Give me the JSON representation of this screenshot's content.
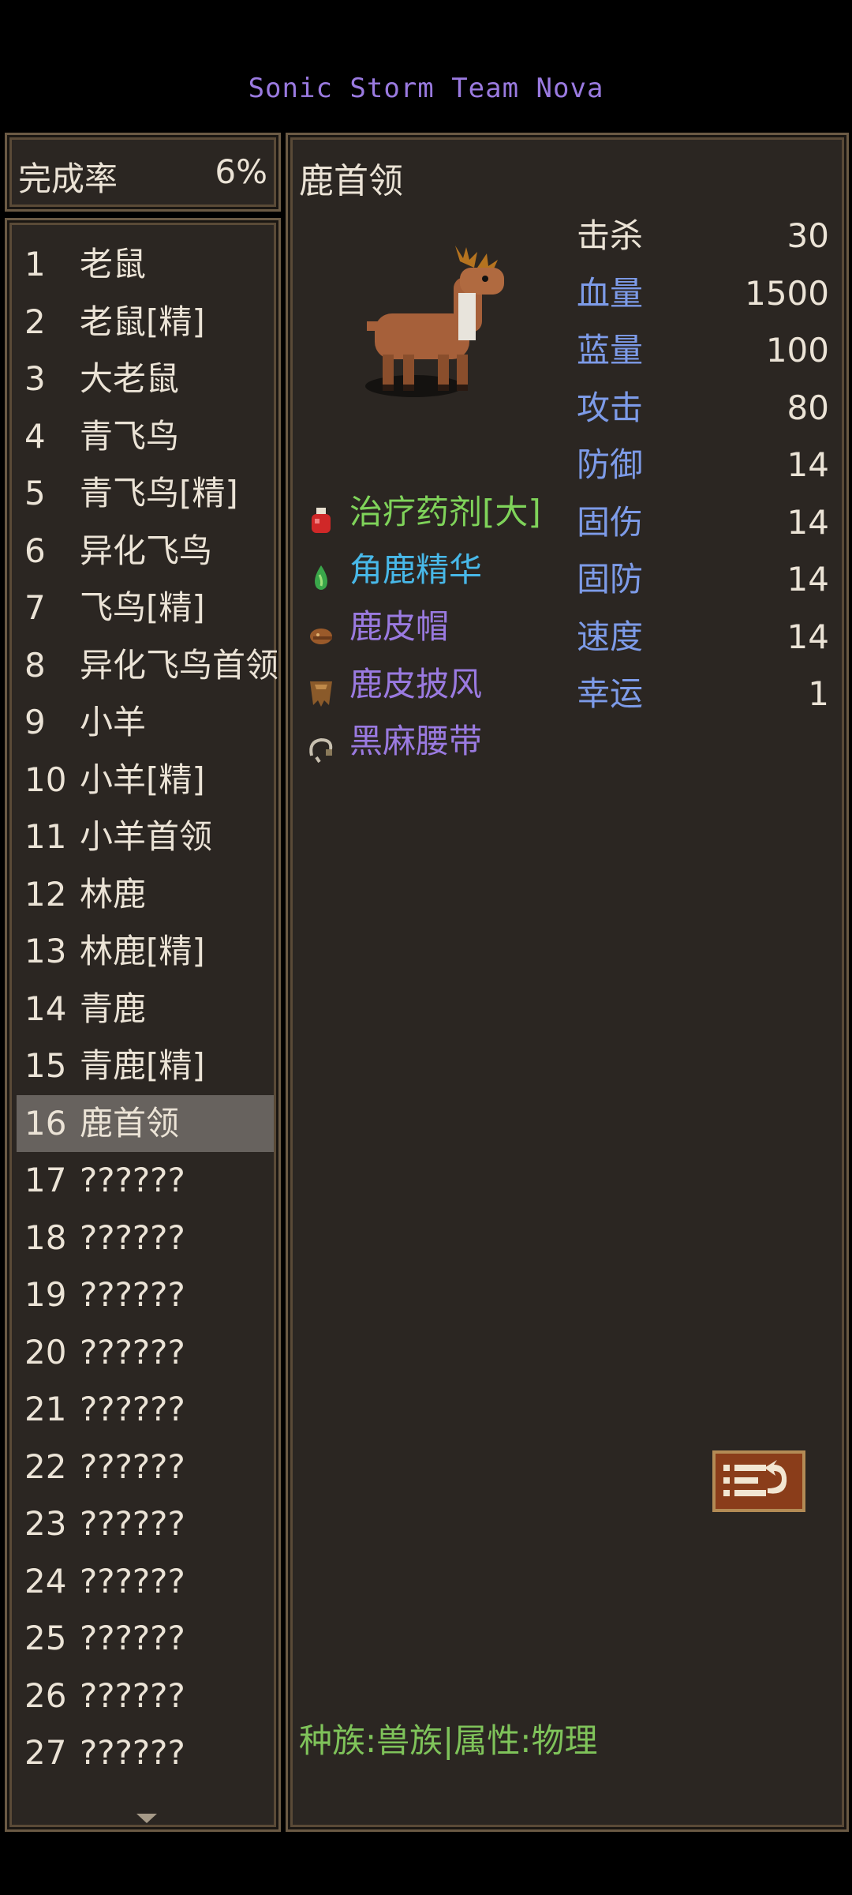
{
  "header": {
    "title": "Sonic Storm Team Nova"
  },
  "completion": {
    "label": "完成率",
    "value": "6%"
  },
  "monster_list": {
    "items": [
      {
        "num": "1",
        "name": "老鼠"
      },
      {
        "num": "2",
        "name": "老鼠[精]"
      },
      {
        "num": "3",
        "name": "大老鼠"
      },
      {
        "num": "4",
        "name": "青飞鸟"
      },
      {
        "num": "5",
        "name": "青飞鸟[精]"
      },
      {
        "num": "6",
        "name": "异化飞鸟"
      },
      {
        "num": "7",
        "name": "飞鸟[精]"
      },
      {
        "num": "8",
        "name": "异化飞鸟首领"
      },
      {
        "num": "9",
        "name": "小羊"
      },
      {
        "num": "10",
        "name": "小羊[精]"
      },
      {
        "num": "11",
        "name": "小羊首领"
      },
      {
        "num": "12",
        "name": "林鹿"
      },
      {
        "num": "13",
        "name": "林鹿[精]"
      },
      {
        "num": "14",
        "name": "青鹿"
      },
      {
        "num": "15",
        "name": "青鹿[精]"
      },
      {
        "num": "16",
        "name": "鹿首领"
      },
      {
        "num": "17",
        "name": "??????"
      },
      {
        "num": "18",
        "name": "??????"
      },
      {
        "num": "19",
        "name": "??????"
      },
      {
        "num": "20",
        "name": "??????"
      },
      {
        "num": "21",
        "name": "??????"
      },
      {
        "num": "22",
        "name": "??????"
      },
      {
        "num": "23",
        "name": "??????"
      },
      {
        "num": "24",
        "name": "??????"
      },
      {
        "num": "25",
        "name": "??????"
      },
      {
        "num": "26",
        "name": "??????"
      },
      {
        "num": "27",
        "name": "??????"
      }
    ],
    "selected_num": "16"
  },
  "detail": {
    "name": "鹿首领",
    "stats": [
      {
        "label": "击杀",
        "value": "30",
        "color": "#ebe3d6"
      },
      {
        "label": "血量",
        "value": "1500",
        "color": "#7d9be8"
      },
      {
        "label": "蓝量",
        "value": "100",
        "color": "#7d9be8"
      },
      {
        "label": "攻击",
        "value": "80",
        "color": "#7d9be8"
      },
      {
        "label": "防御",
        "value": "14",
        "color": "#7d9be8"
      },
      {
        "label": "固伤",
        "value": "14",
        "color": "#7d9be8"
      },
      {
        "label": "固防",
        "value": "14",
        "color": "#7d9be8"
      },
      {
        "label": "速度",
        "value": "14",
        "color": "#7d9be8"
      },
      {
        "label": "幸运",
        "value": "1",
        "color": "#7d9be8"
      }
    ],
    "drops": [
      {
        "name": "治疗药剂[大]",
        "color": "#7fd35a",
        "icon": "potion-icon"
      },
      {
        "name": "角鹿精华",
        "color": "#48b8e8",
        "icon": "essence-icon"
      },
      {
        "name": "鹿皮帽",
        "color": "#9a7ae0",
        "icon": "hat-icon"
      },
      {
        "name": "鹿皮披风",
        "color": "#9a7ae0",
        "icon": "cape-icon"
      },
      {
        "name": "黑麻腰带",
        "color": "#9a7ae0",
        "icon": "belt-icon"
      }
    ],
    "info": "种族:兽族|属性:物理"
  }
}
